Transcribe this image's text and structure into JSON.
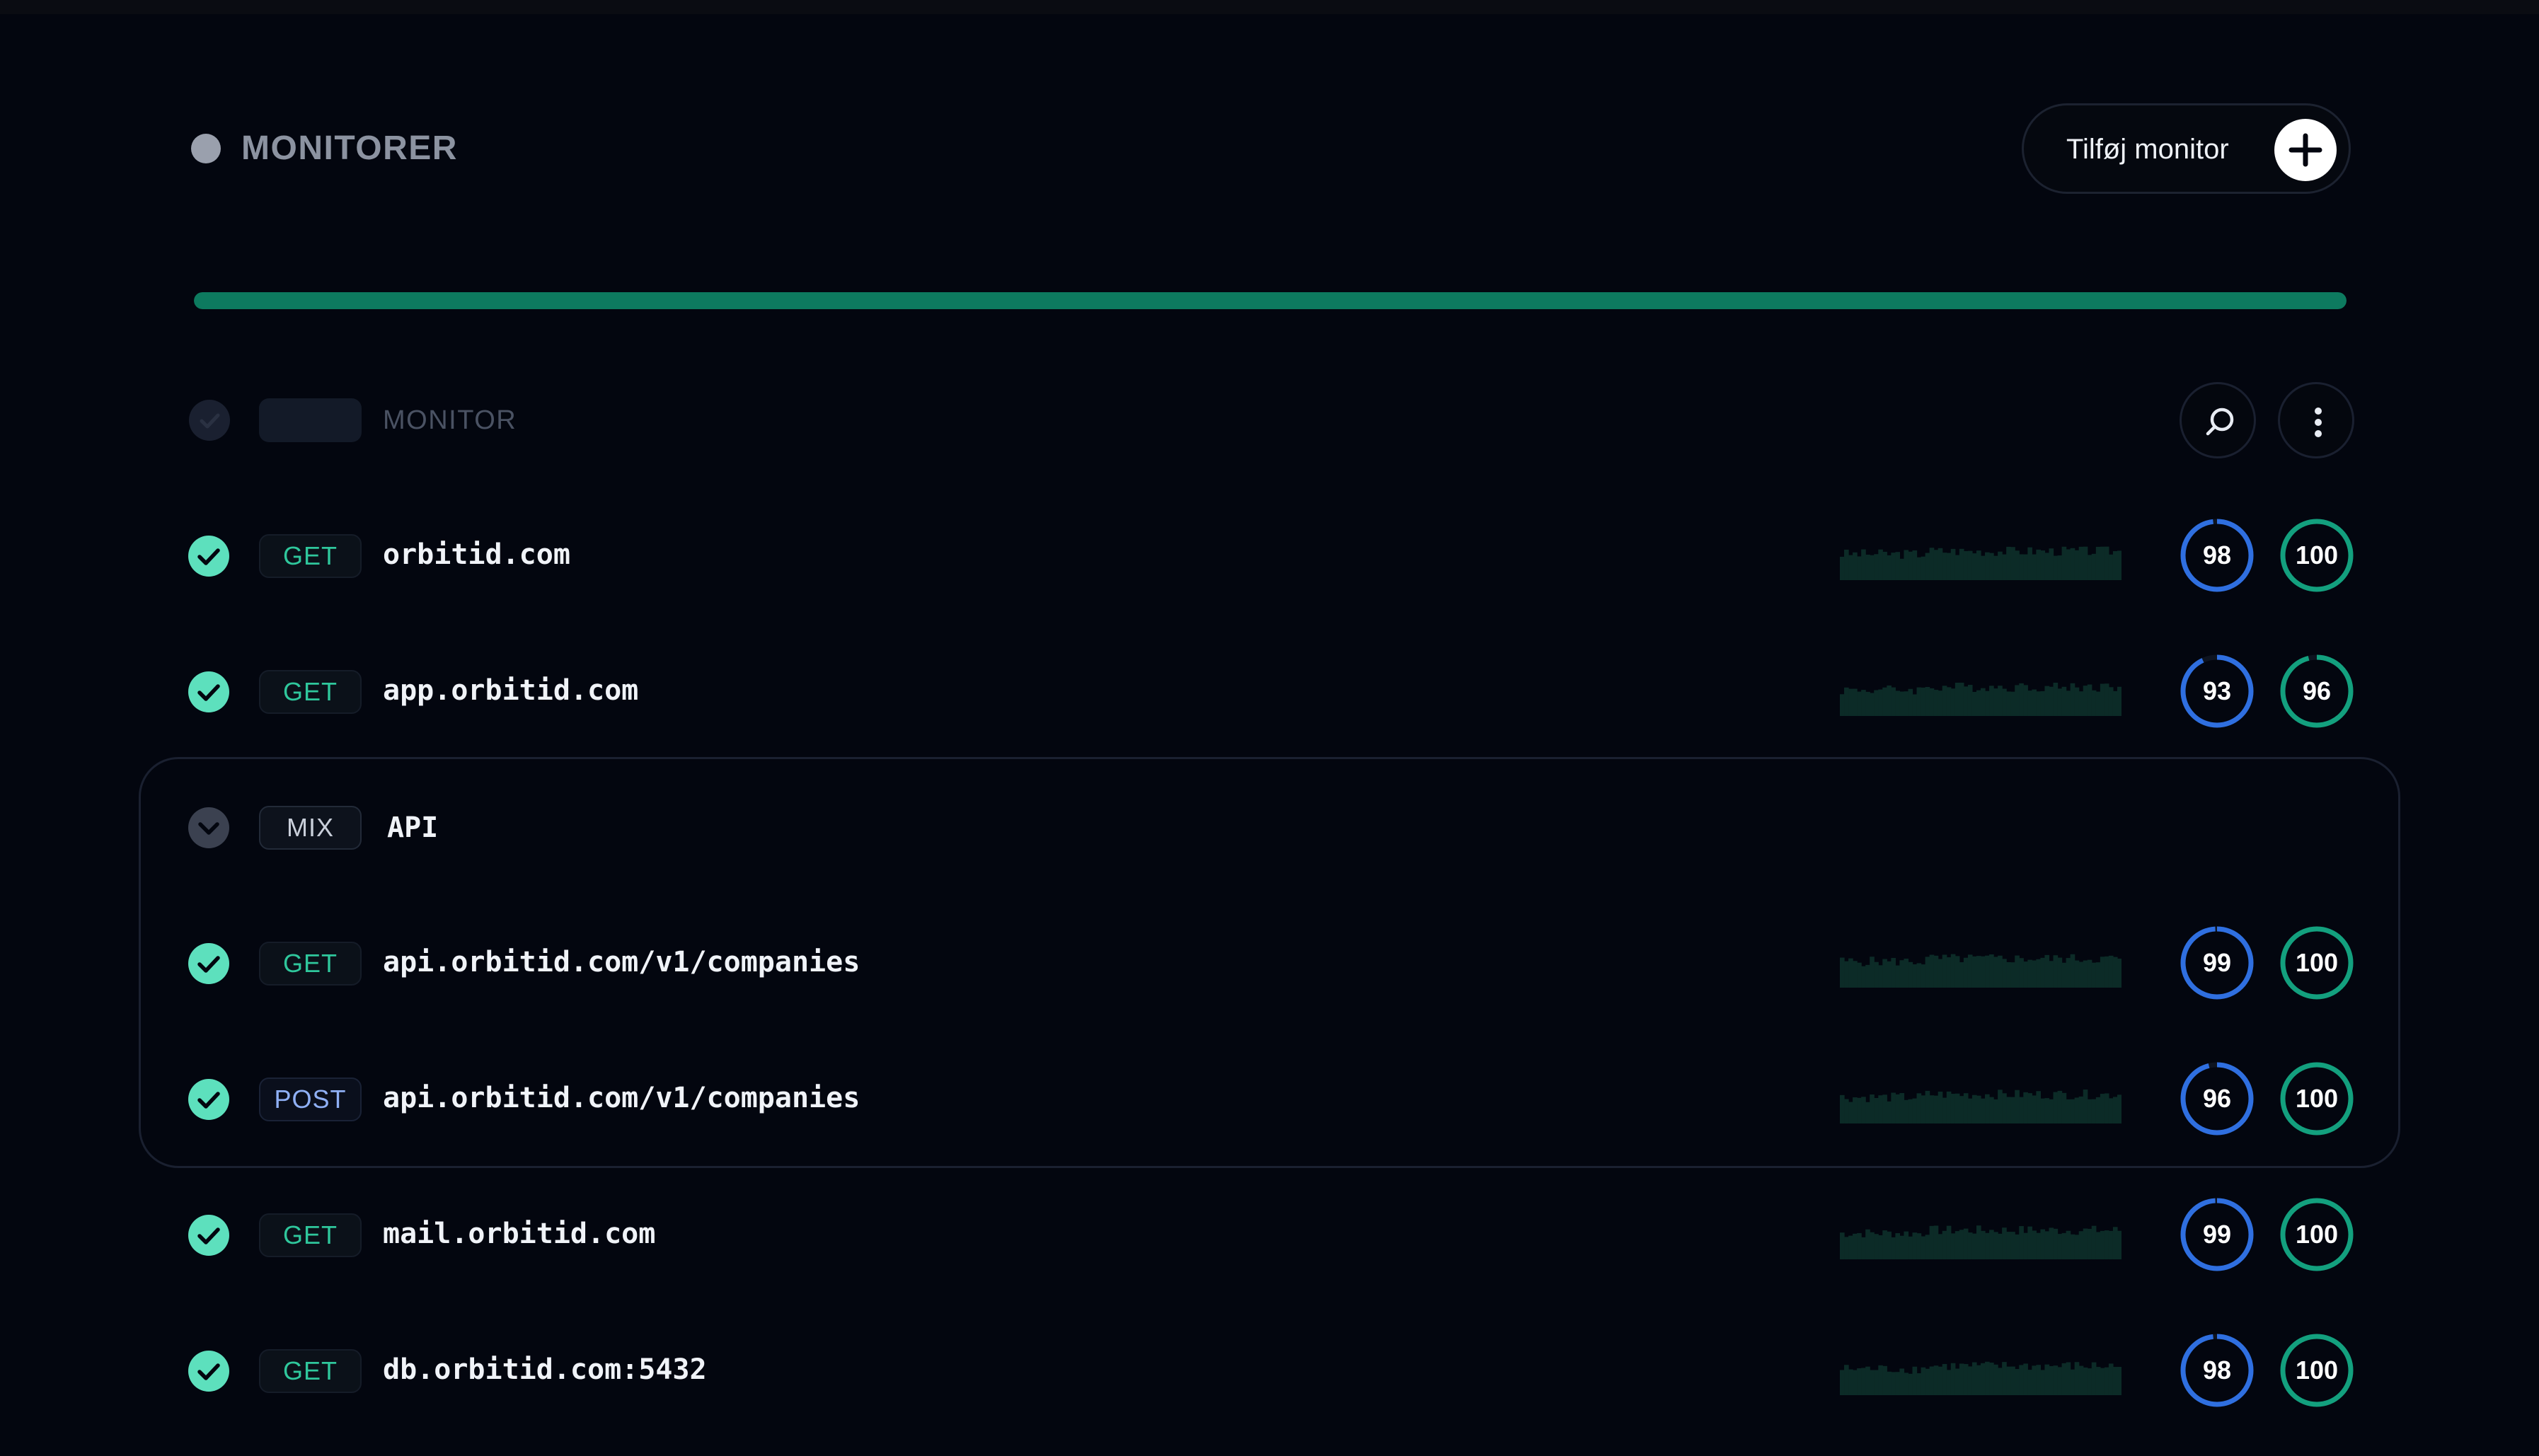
{
  "header": {
    "title": "MONITORER",
    "add_button_label": "Tilføj monitor"
  },
  "colors": {
    "background": "#03060f",
    "accent_green": "#0d7a5f",
    "status_green": "#5de0bd",
    "gauge_blue": "#2f6fe0",
    "gauge_green": "#13a07e",
    "method_get": "#2fc79c",
    "method_post": "#8fb0f5"
  },
  "overall_uptime": {
    "fraction": 1.0
  },
  "table_header": {
    "column_label": "MONITOR",
    "search_icon": "search-icon",
    "menu_icon": "more-vertical-icon"
  },
  "rows": [
    {
      "status": "up",
      "method": "GET",
      "url": "orbitid.com",
      "score_a": "98",
      "score_b": "100"
    },
    {
      "status": "up",
      "method": "GET",
      "url": "app.orbitid.com",
      "score_a": "93",
      "score_b": "96"
    }
  ],
  "group": {
    "method": "MIX",
    "name": "API",
    "expanded": true,
    "rows": [
      {
        "status": "up",
        "method": "GET",
        "url": "api.orbitid.com/v1/companies",
        "score_a": "99",
        "score_b": "100"
      },
      {
        "status": "up",
        "method": "POST",
        "url": "api.orbitid.com/v1/companies",
        "score_a": "96",
        "score_b": "100"
      }
    ]
  },
  "rows_after": [
    {
      "status": "up",
      "method": "GET",
      "url": "mail.orbitid.com",
      "score_a": "99",
      "score_b": "100"
    },
    {
      "status": "up",
      "method": "GET",
      "url": "db.orbitid.com:5432",
      "score_a": "98",
      "score_b": "100"
    }
  ]
}
